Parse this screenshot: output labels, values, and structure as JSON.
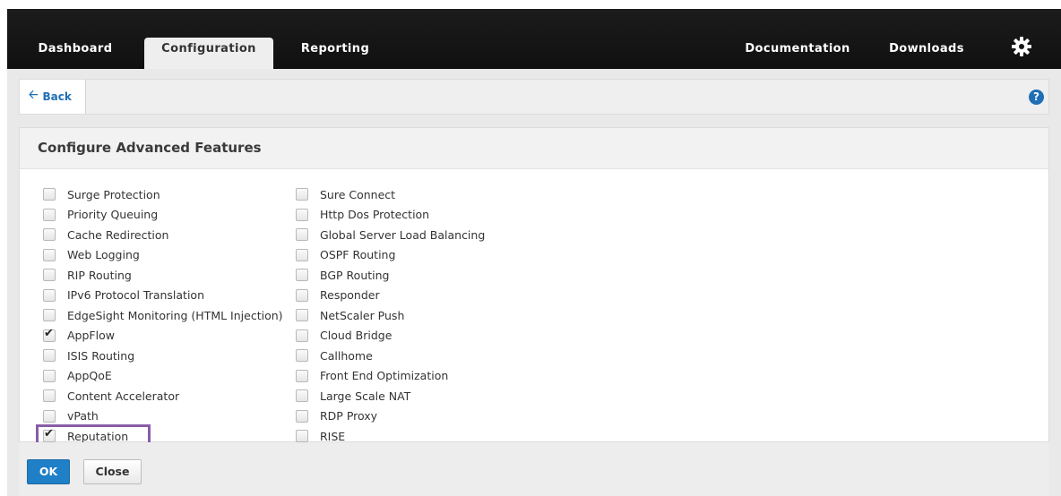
{
  "nav": {
    "tabs": [
      {
        "label": "Dashboard"
      },
      {
        "label": "Configuration",
        "active": true
      },
      {
        "label": "Reporting"
      }
    ],
    "right_links": [
      {
        "label": "Documentation"
      },
      {
        "label": "Downloads"
      }
    ],
    "settings_icon": "gear-icon"
  },
  "subbar": {
    "back_label": "Back",
    "help_icon": "help-icon",
    "help_glyph": "?"
  },
  "panel": {
    "title": "Configure Advanced Features",
    "left_options": [
      {
        "label": "Surge Protection",
        "checked": false
      },
      {
        "label": "Priority Queuing",
        "checked": false
      },
      {
        "label": "Cache Redirection",
        "checked": false
      },
      {
        "label": "Web Logging",
        "checked": false
      },
      {
        "label": "RIP Routing",
        "checked": false
      },
      {
        "label": "IPv6 Protocol Translation",
        "checked": false
      },
      {
        "label": "EdgeSight Monitoring (HTML Injection)",
        "checked": false
      },
      {
        "label": "AppFlow",
        "checked": true
      },
      {
        "label": "ISIS Routing",
        "checked": false
      },
      {
        "label": "AppQoE",
        "checked": false
      },
      {
        "label": "Content Accelerator",
        "checked": false
      },
      {
        "label": "vPath",
        "checked": false
      },
      {
        "label": "Reputation",
        "checked": true,
        "highlighted": true
      }
    ],
    "right_options": [
      {
        "label": "Sure Connect",
        "checked": false
      },
      {
        "label": "Http Dos Protection",
        "checked": false
      },
      {
        "label": "Global Server Load Balancing",
        "checked": false
      },
      {
        "label": "OSPF Routing",
        "checked": false
      },
      {
        "label": "BGP Routing",
        "checked": false
      },
      {
        "label": "Responder",
        "checked": false
      },
      {
        "label": "NetScaler Push",
        "checked": false
      },
      {
        "label": "Cloud Bridge",
        "checked": false
      },
      {
        "label": "Callhome",
        "checked": false
      },
      {
        "label": "Front End Optimization",
        "checked": false
      },
      {
        "label": "Large Scale NAT",
        "checked": false
      },
      {
        "label": "RDP Proxy",
        "checked": false
      },
      {
        "label": "RISE",
        "checked": false
      }
    ]
  },
  "footer": {
    "ok_label": "OK",
    "close_label": "Close"
  },
  "colors": {
    "accent": "#1f7fc7",
    "highlight_border": "#8a5ca8",
    "topbar": "#151515"
  }
}
